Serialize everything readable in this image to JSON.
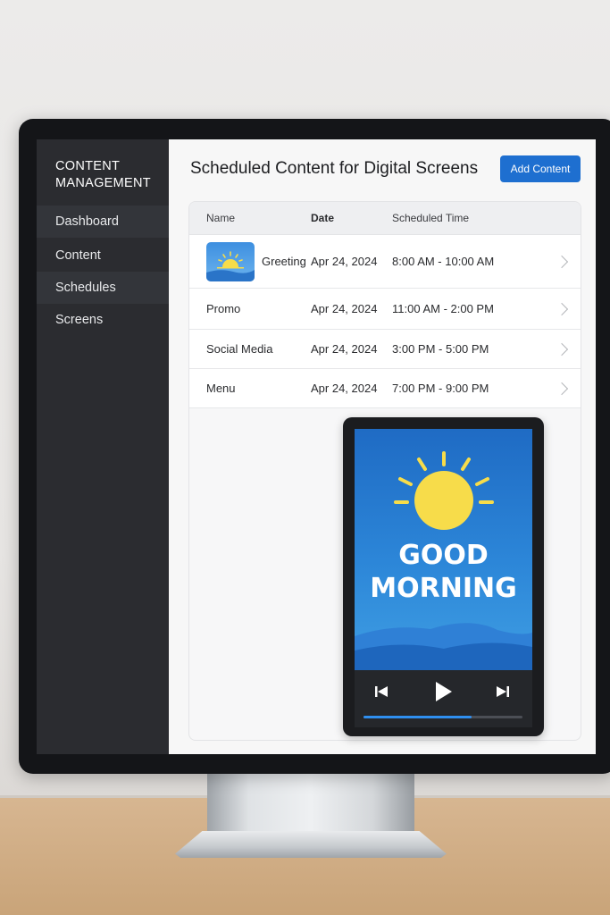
{
  "sidebar": {
    "title": "CONTENT\nMANAGEMENT",
    "items": [
      {
        "label": "Dashboard"
      },
      {
        "label": "Content"
      },
      {
        "label": "Schedules"
      },
      {
        "label": "Screens"
      }
    ]
  },
  "header": {
    "title": "Scheduled Content for Digital Screens",
    "add_button_label": "Add Content"
  },
  "table": {
    "columns": [
      "Name",
      "Date",
      "Scheduled Time"
    ],
    "rows": [
      {
        "name": "Greeting",
        "date": "Apr 24, 2024",
        "time": "8:00 AM - 10:00 AM",
        "icon": "sun-thumbnail-icon"
      },
      {
        "name": "Promo",
        "date": "Apr 24, 2024",
        "time": "11:00 AM - 2:00 PM"
      },
      {
        "name": "Social Media",
        "date": "Apr 24, 2024",
        "time": "3:00 PM - 5:00 PM"
      },
      {
        "name": "Menu",
        "date": "Apr 24, 2024",
        "time": "7:00 PM - 9:00 PM"
      }
    ]
  },
  "preview": {
    "line1": "GOOD",
    "line2": "MORNING",
    "progress": 0.68,
    "icons": [
      "previous-icon",
      "play-icon",
      "next-icon"
    ]
  },
  "colors": {
    "accent": "#1e6fd0",
    "sidebar": "#2b2c30",
    "sun": "#f7dc4a"
  }
}
